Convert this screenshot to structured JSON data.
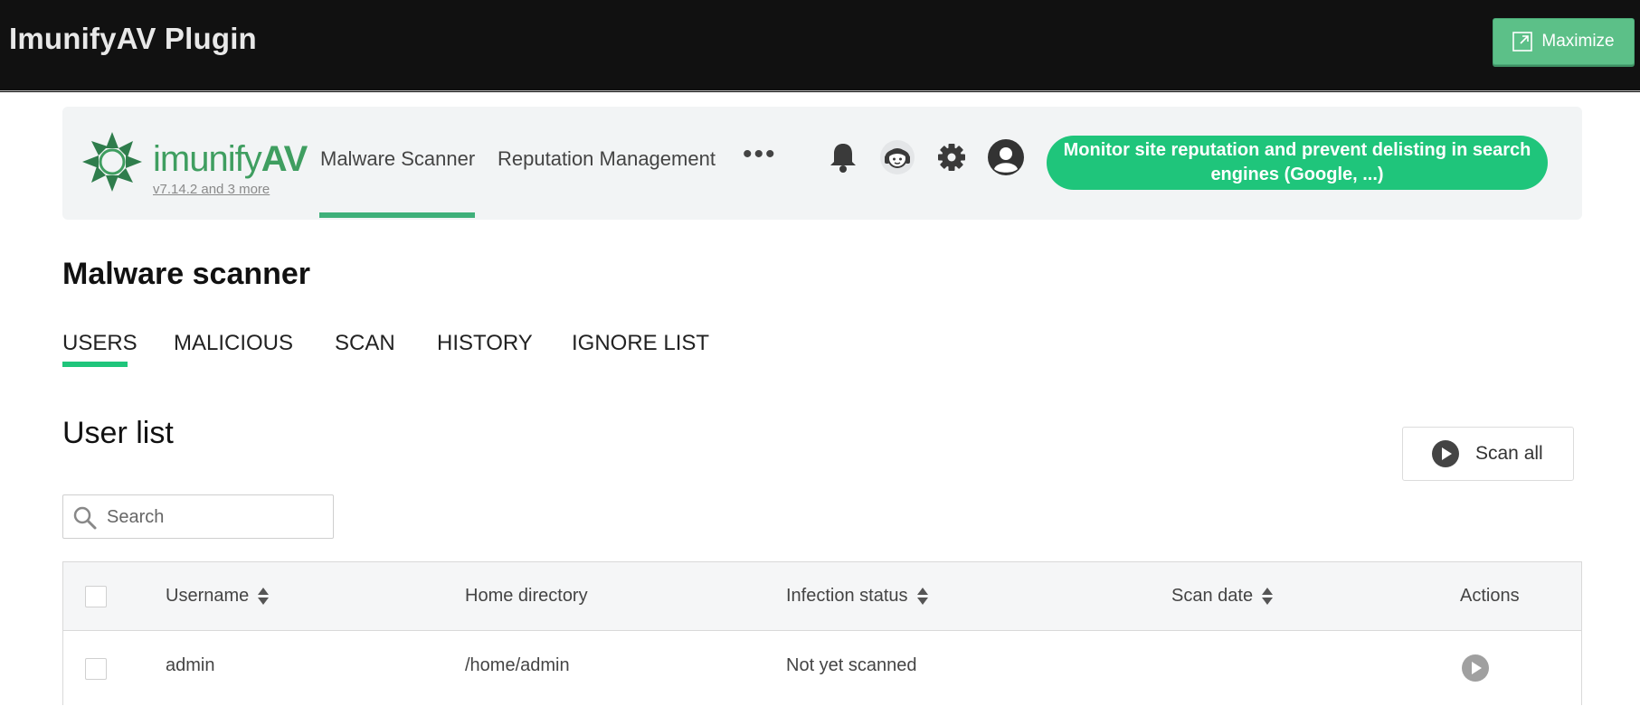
{
  "window": {
    "title": "ImunifyAV Plugin",
    "maximize_label": "Maximize"
  },
  "header": {
    "brand_name": "imunify",
    "brand_suffix": "AV",
    "version": "v7.14.2 and 3 more",
    "nav": [
      "Malware Scanner",
      "Reputation Management"
    ],
    "more": "•••",
    "icons": [
      "bell-icon",
      "support-agent-icon",
      "gear-icon",
      "user-avatar-icon"
    ],
    "promo": "Monitor site reputation and prevent delisting in search engines (Google, ...)"
  },
  "main": {
    "page_title": "Malware scanner",
    "tabs": [
      "USERS",
      "MALICIOUS",
      "SCAN",
      "HISTORY",
      "IGNORE LIST"
    ],
    "active_tab": "USERS",
    "section_title": "User list",
    "scan_all_label": "Scan all",
    "search_placeholder": "Search"
  },
  "table": {
    "columns": [
      "Username",
      "Home directory",
      "Infection status",
      "Scan date",
      "Actions"
    ],
    "rows": [
      {
        "username": "admin",
        "home": "/home/admin",
        "status": "Not yet scanned",
        "scan_date": ""
      }
    ]
  },
  "colors": {
    "accent": "#1fc57b",
    "brand": "#3f9e60",
    "topbar": "#111111",
    "maximize": "#5cc088"
  }
}
